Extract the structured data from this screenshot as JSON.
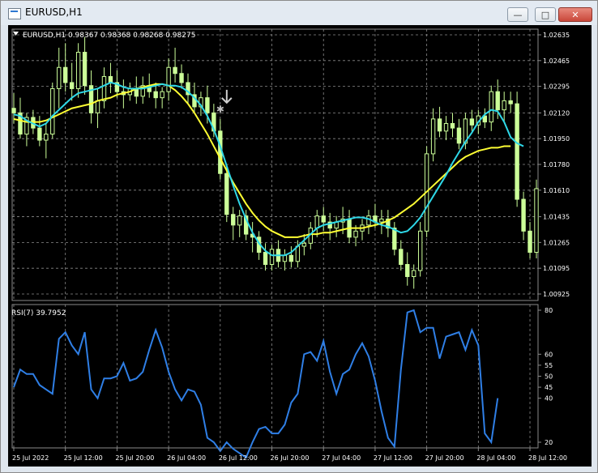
{
  "window": {
    "title": "EURUSD,H1",
    "minimize": "—",
    "maximize": "□",
    "close": "✕"
  },
  "chart_data": {
    "type": "line",
    "symbol_header": "EURUSD,H1  0.98367 0.98368 0.98268 0.98275",
    "price_ticks": [
      "1.02635",
      "1.02465",
      "1.02295",
      "1.02120",
      "1.01950",
      "1.01780",
      "1.01610",
      "1.01435",
      "1.01265",
      "1.01095",
      "1.00925"
    ],
    "time_labels": [
      "25 Jul 2022",
      "25 Jul 12:00",
      "25 Jul 20:00",
      "26 Jul 04:00",
      "26 Jul 12:00",
      "26 Jul 20:00",
      "27 Jul 04:00",
      "27 Jul 12:00",
      "27 Jul 20:00",
      "28 Jul 04:00",
      "28 Jul 12:00"
    ],
    "indicator_label": "RSI(7) 39.7952",
    "rsi_ticks": [
      "80",
      "60",
      "55",
      "50",
      "45",
      "40",
      "20"
    ],
    "rsi_ylim": [
      20,
      80
    ],
    "price_ylim": [
      1.00925,
      1.02635
    ],
    "colors": {
      "candles": "#ccff99",
      "ma_fast": "#2ed8e8",
      "ma_slow": "#ffff33",
      "rsi": "#2f7fe6",
      "grid": "#8a8a8a",
      "text": "#ffffff"
    },
    "candles": [
      [
        1.0215,
        1.0225,
        1.0205,
        1.0212
      ],
      [
        1.0212,
        1.0222,
        1.0195,
        1.0198
      ],
      [
        1.0198,
        1.0212,
        1.019,
        1.0209
      ],
      [
        1.0209,
        1.0214,
        1.0198,
        1.0202
      ],
      [
        1.0202,
        1.021,
        1.019,
        1.0194
      ],
      [
        1.0194,
        1.0205,
        1.0182,
        1.0198
      ],
      [
        1.0198,
        1.0232,
        1.0195,
        1.0228
      ],
      [
        1.0228,
        1.0255,
        1.0215,
        1.0242
      ],
      [
        1.0242,
        1.0258,
        1.0226,
        1.0232
      ],
      [
        1.0232,
        1.0245,
        1.022,
        1.0228
      ],
      [
        1.0228,
        1.0258,
        1.0222,
        1.0252
      ],
      [
        1.0252,
        1.0262,
        1.0224,
        1.023
      ],
      [
        1.023,
        1.024,
        1.0205,
        1.0212
      ],
      [
        1.0212,
        1.0228,
        1.0202,
        1.022
      ],
      [
        1.022,
        1.0242,
        1.0215,
        1.0236
      ],
      [
        1.0236,
        1.0245,
        1.0225,
        1.0232
      ],
      [
        1.0232,
        1.024,
        1.0222,
        1.0226
      ],
      [
        1.0226,
        1.0234,
        1.0215,
        1.0224
      ],
      [
        1.0224,
        1.0232,
        1.022,
        1.0228
      ],
      [
        1.0228,
        1.0236,
        1.0218,
        1.0223
      ],
      [
        1.0223,
        1.0236,
        1.0218,
        1.023
      ],
      [
        1.023,
        1.0238,
        1.0222,
        1.0226
      ],
      [
        1.0226,
        1.0232,
        1.0215,
        1.0222
      ],
      [
        1.0222,
        1.0229,
        1.0215,
        1.0226
      ],
      [
        1.0226,
        1.0248,
        1.022,
        1.0242
      ],
      [
        1.0242,
        1.0255,
        1.0232,
        1.0238
      ],
      [
        1.0238,
        1.0244,
        1.0228,
        1.0232
      ],
      [
        1.0232,
        1.0238,
        1.0218,
        1.0224
      ],
      [
        1.0224,
        1.0232,
        1.0212,
        1.0216
      ],
      [
        1.0216,
        1.0226,
        1.021,
        1.0222
      ],
      [
        1.0222,
        1.023,
        1.0205,
        1.0212
      ],
      [
        1.0212,
        1.0218,
        1.0196,
        1.02
      ],
      [
        1.02,
        1.0208,
        1.0168,
        1.0172
      ],
      [
        1.0172,
        1.0178,
        1.014,
        1.0145
      ],
      [
        1.0145,
        1.015,
        1.0128,
        1.0138
      ],
      [
        1.0138,
        1.0148,
        1.013,
        1.0144
      ],
      [
        1.0144,
        1.0148,
        1.0128,
        1.0132
      ],
      [
        1.0132,
        1.014,
        1.012,
        1.013
      ],
      [
        1.013,
        1.0134,
        1.0115,
        1.012
      ],
      [
        1.012,
        1.0126,
        1.0108,
        1.0112
      ],
      [
        1.0112,
        1.0125,
        1.0108,
        1.0122
      ],
      [
        1.0122,
        1.0128,
        1.011,
        1.0114
      ],
      [
        1.0114,
        1.0122,
        1.0108,
        1.0118
      ],
      [
        1.0118,
        1.0124,
        1.011,
        1.0114
      ],
      [
        1.0114,
        1.0128,
        1.011,
        1.0124
      ],
      [
        1.0124,
        1.0132,
        1.0118,
        1.0126
      ],
      [
        1.0126,
        1.014,
        1.0122,
        1.0136
      ],
      [
        1.0136,
        1.0148,
        1.013,
        1.0144
      ],
      [
        1.0144,
        1.015,
        1.0134,
        1.014
      ],
      [
        1.014,
        1.0146,
        1.0128,
        1.0136
      ],
      [
        1.0136,
        1.0144,
        1.013,
        1.014
      ],
      [
        1.014,
        1.015,
        1.0132,
        1.0142
      ],
      [
        1.0142,
        1.0148,
        1.0126,
        1.013
      ],
      [
        1.013,
        1.0138,
        1.0124,
        1.0134
      ],
      [
        1.0134,
        1.0142,
        1.0128,
        1.0138
      ],
      [
        1.0138,
        1.0148,
        1.0132,
        1.0144
      ],
      [
        1.0144,
        1.0152,
        1.0136,
        1.014
      ],
      [
        1.014,
        1.0148,
        1.0132,
        1.0142
      ],
      [
        1.0142,
        1.0148,
        1.013,
        1.0136
      ],
      [
        1.0136,
        1.014,
        1.0118,
        1.0122
      ],
      [
        1.0122,
        1.0128,
        1.0108,
        1.0112
      ],
      [
        1.0112,
        1.012,
        1.0098,
        1.0104
      ],
      [
        1.0104,
        1.0112,
        1.0096,
        1.0108
      ],
      [
        1.0108,
        1.014,
        1.0104,
        1.0134
      ],
      [
        1.0134,
        1.019,
        1.013,
        1.0185
      ],
      [
        1.0185,
        1.0215,
        1.018,
        1.0208
      ],
      [
        1.0208,
        1.0216,
        1.0196,
        1.02
      ],
      [
        1.02,
        1.021,
        1.0194,
        1.0205
      ],
      [
        1.0205,
        1.0212,
        1.0196,
        1.0202
      ],
      [
        1.0202,
        1.0208,
        1.0188,
        1.0192
      ],
      [
        1.0192,
        1.0212,
        1.0188,
        1.0208
      ],
      [
        1.0208,
        1.0214,
        1.02,
        1.0204
      ],
      [
        1.0204,
        1.0214,
        1.0198,
        1.021
      ],
      [
        1.021,
        1.0215,
        1.0202,
        1.0206
      ],
      [
        1.0206,
        1.023,
        1.02,
        1.0226
      ],
      [
        1.0226,
        1.0234,
        1.0208,
        1.0214
      ],
      [
        1.0214,
        1.0226,
        1.0206,
        1.022
      ],
      [
        1.022,
        1.0226,
        1.0212,
        1.0218
      ],
      [
        1.0218,
        1.0226,
        1.015,
        1.0155
      ],
      [
        1.0155,
        1.016,
        1.0128,
        1.0134
      ],
      [
        1.0134,
        1.014,
        1.0116,
        1.012
      ],
      [
        1.012,
        1.0168,
        1.0116,
        1.0162
      ]
    ],
    "ma_fast": [
      1.0211,
      1.021,
      1.0207,
      1.0205,
      1.0203,
      1.0205,
      1.021,
      1.0214,
      1.0218,
      1.0222,
      1.0225,
      1.0226,
      1.0227,
      1.0228,
      1.023,
      1.0232,
      1.0231,
      1.0229,
      1.0228,
      1.0228,
      1.0228,
      1.0229,
      1.023,
      1.0231,
      1.023,
      1.023,
      1.0229,
      1.0226,
      1.0222,
      1.0217,
      1.021,
      1.0201,
      1.019,
      1.0177,
      1.0164,
      1.0152,
      1.0142,
      1.0133,
      1.0126,
      1.0121,
      1.0118,
      1.0118,
      1.0118,
      1.012,
      1.0124,
      1.0128,
      1.0132,
      1.0136,
      1.0138,
      1.0139,
      1.014,
      1.0141,
      1.0142,
      1.0143,
      1.0143,
      1.0142,
      1.014,
      1.0138,
      1.0137,
      1.0135,
      1.0133,
      1.0134,
      1.0138,
      1.0143,
      1.015,
      1.0157,
      1.0164,
      1.0171,
      1.0179,
      1.0186,
      1.0193,
      1.0199,
      1.0206,
      1.0211,
      1.0214,
      1.0213,
      1.0206,
      1.0196,
      1.0192,
      1.019
    ],
    "ma_slow": [
      1.0208,
      1.0207,
      1.0206,
      1.0206,
      1.0206,
      1.0207,
      1.0209,
      1.0211,
      1.0213,
      1.0215,
      1.0216,
      1.0217,
      1.0218,
      1.022,
      1.0221,
      1.0222,
      1.0224,
      1.0225,
      1.0226,
      1.0228,
      1.0229,
      1.023,
      1.0231,
      1.0231,
      1.023,
      1.0227,
      1.0223,
      1.0218,
      1.0212,
      1.0205,
      1.0198,
      1.019,
      1.0182,
      1.0174,
      1.0166,
      1.0159,
      1.0152,
      1.0146,
      1.0141,
      1.0137,
      1.0134,
      1.0132,
      1.013,
      1.013,
      1.013,
      1.0131,
      1.0132,
      1.0132,
      1.0133,
      1.0133,
      1.0134,
      1.0135,
      1.0136,
      1.0136,
      1.0136,
      1.0137,
      1.0138,
      1.0139,
      1.0141,
      1.0143,
      1.0146,
      1.0149,
      1.0152,
      1.0156,
      1.016,
      1.0164,
      1.0168,
      1.0172,
      1.0176,
      1.018,
      1.0183,
      1.0185,
      1.0187,
      1.0188,
      1.0189,
      1.0189,
      1.019,
      1.019
    ],
    "rsi": [
      45,
      53,
      51,
      51,
      46,
      44,
      42,
      67,
      70,
      64,
      60,
      70,
      44,
      40,
      49,
      49,
      50,
      56,
      48,
      49,
      52,
      62,
      71,
      63,
      52,
      44,
      39,
      44,
      43,
      37,
      22,
      20,
      16,
      20,
      17,
      15,
      13,
      20,
      26,
      27,
      24,
      24,
      28,
      38,
      42,
      60,
      61,
      57,
      66,
      52,
      42,
      51,
      53,
      60,
      65,
      59,
      48,
      34,
      22,
      18,
      53,
      79,
      80,
      70,
      72,
      72,
      58,
      68,
      69,
      70,
      62,
      71,
      64,
      24,
      20,
      40
    ],
    "arrow_bar": 32
  }
}
